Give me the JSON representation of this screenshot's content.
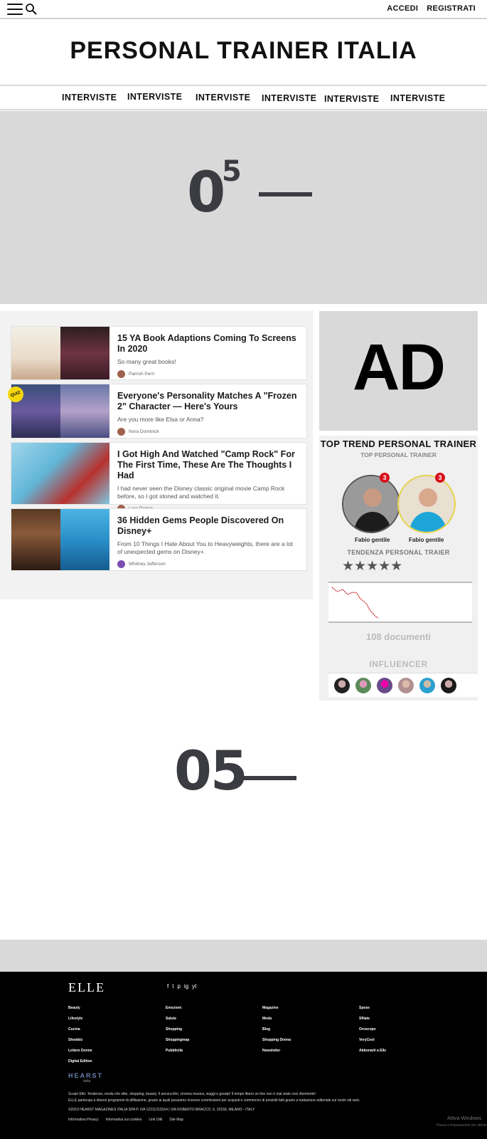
{
  "topbar": {
    "login": "ACCEDI",
    "register": "REGISTRATI"
  },
  "site": {
    "title": "PERSONAL TRAINER ITALIA"
  },
  "nav": {
    "items": [
      "INTERVISTE",
      "INTERVISTE",
      "INTERVISTE",
      "INTERVISTE",
      "INTERVISTE",
      "INTERVISTE"
    ]
  },
  "hero": {
    "number": "0",
    "superscript": "5"
  },
  "articles": [
    {
      "title": "15 YA Book Adaptions Coming To Screens In 2020",
      "subtitle": "So many great books!",
      "author": "Parrish Perri"
    },
    {
      "title": "Everyone's Personality Matches A \"Frozen 2\" Character — Here's Yours",
      "subtitle": "Are you more like Elsa or Anna?",
      "author": "Nora Dominick",
      "badge": "QUIZ"
    },
    {
      "title": "I Got High And Watched \"Camp Rock\" For The First Time, These Are The Thoughts I Had",
      "subtitle": "I had never seen the Disney classic original movie Camp Rock before, so I got stoned and watched it.",
      "author": "Lara Parker"
    },
    {
      "title": "36 Hidden Gems People Discovered On Disney+",
      "subtitle": "From 10 Things I Hate About You to Heavyweights, there are a lot of unexpected gems on Disney+.",
      "author": "Whitney Jefferson"
    }
  ],
  "ad": {
    "label": "AD"
  },
  "trainer": {
    "title": "TOP  TREND PERSONAL TRAINER",
    "subtitle": "TOP PERSONAL TRAINER",
    "people": [
      {
        "name": "Fabio gentile",
        "badge": "3"
      },
      {
        "name": "Fabio gentile",
        "badge": "3"
      }
    ],
    "tendency": "TENDENZA PERSONAL TRAIER",
    "rating": 5,
    "stars": "★★★★★",
    "documents": "108 documenti",
    "influencer_label": "INFLUENCER"
  },
  "lower": {
    "number": "05"
  },
  "footer": {
    "logo": "ELLE",
    "socials": [
      "f",
      "t",
      "p",
      "ig",
      "yt"
    ],
    "columns": [
      [
        "Beauty",
        "Lifestyle",
        "Cucina",
        "Showbiz",
        "Lettere Donne",
        "Digital Edition"
      ],
      [
        "Emozioni",
        "Salute",
        "Shopping",
        "Shoppingmap",
        "Pubblicità"
      ],
      [
        "Magazine",
        "Moda",
        "Blog",
        "Shopping Donna",
        "Newsletter"
      ],
      [
        "Spose",
        "Sfilate",
        "Oroscopo",
        "VeryCool",
        "Abbonarti a Elle"
      ]
    ],
    "publisher": "HEARST",
    "publisher_sub": "italia",
    "legal1": "Scopri Elle: Tendenze, moda che stile, shopping, beauty. Il ancora libri, cinema musica, viaggi e gossip! Il tempo libero on line non è mai stato così divertente!",
    "legal2": "ELLE partecipa a diversi programmi di affiliazione, grazie ai quali possiamo ricevere commissioni per acquisti e commercio di prodotti fatti grazie a trattazione editoriale sui nostri siti web.",
    "legal3": "©2019 HEARST MAGAZINES ITALIA SPA P. IVA 12211210154 | VIA ROBERTO BRACCO, 6, 20159, MILANO - ITALY",
    "links": [
      "Informativa Privacy",
      "Informativa sui cookies",
      "Link Utili",
      "Site Map"
    ],
    "windows": "Attiva Windows",
    "windows_sub": "Passa a Impostazioni per attivar"
  }
}
